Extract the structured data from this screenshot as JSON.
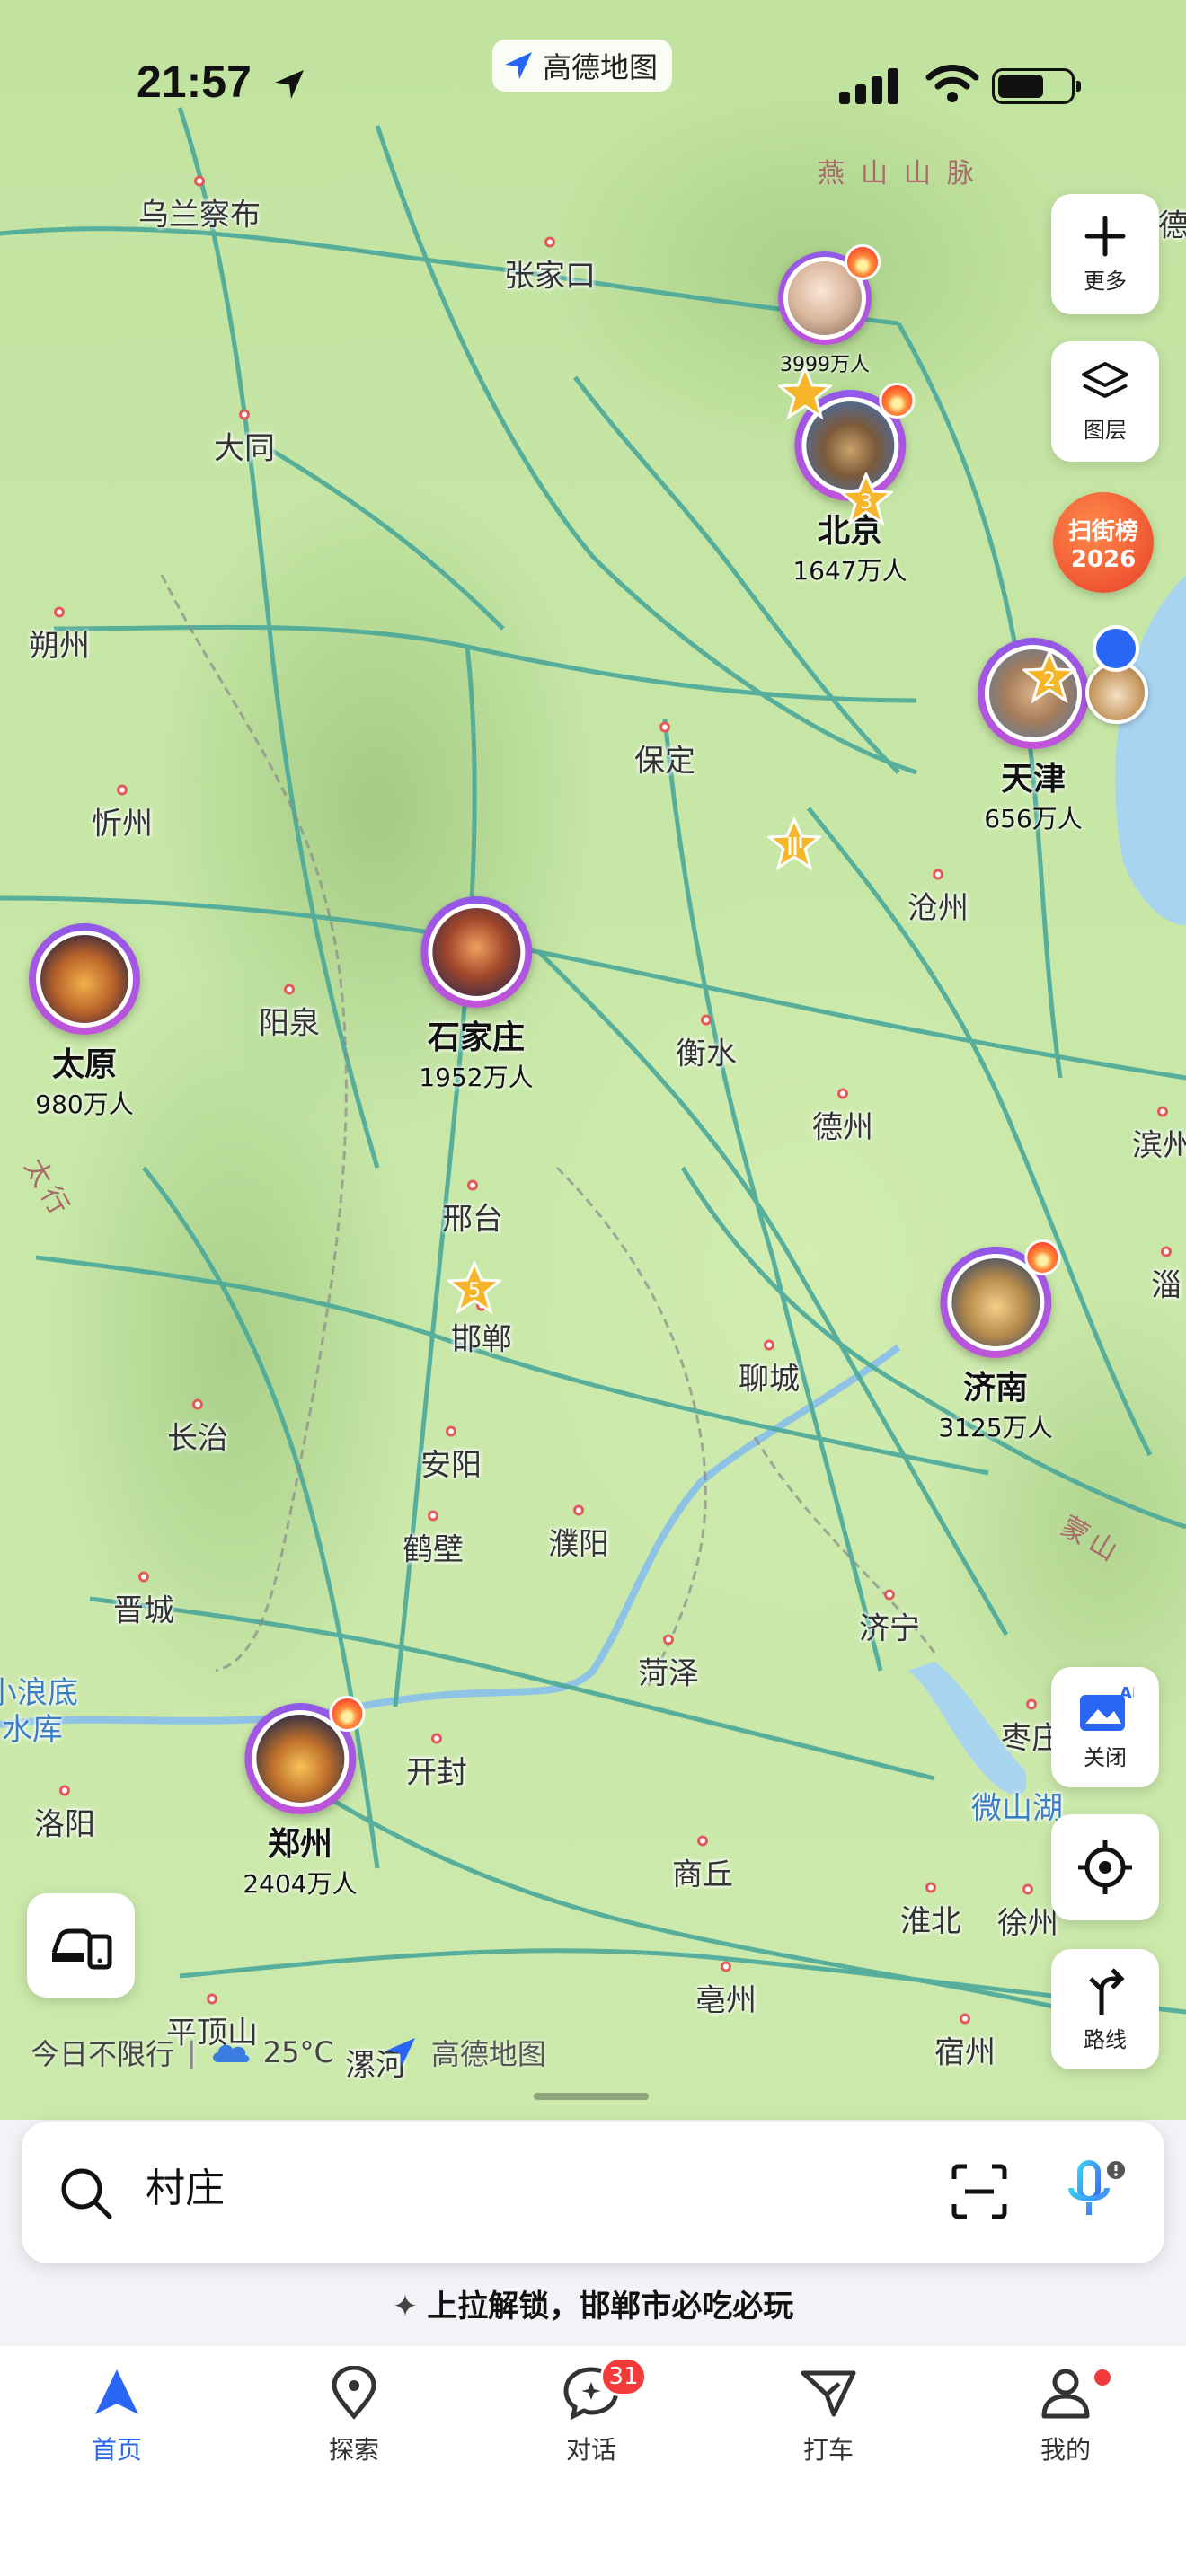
{
  "status": {
    "time": "21:57",
    "app_badge": "高德地图"
  },
  "mountain_labels": {
    "yanshan": "燕山山脉",
    "taihang": "太行",
    "mengshan": "蒙山"
  },
  "cities": {
    "wulanchabu": "乌兰察布",
    "zhangjiakou": "张家口",
    "datong": "大同",
    "shuozhou": "朔州",
    "xinzhou": "忻州",
    "baoding": "保定",
    "cangzhou": "沧州",
    "yangquan": "阳泉",
    "hengshui": "衡水",
    "dezhou": "德州",
    "binzhou": "滨州",
    "xingtai": "邢台",
    "handan": "邯郸",
    "liaocheng": "聊城",
    "zibo": "淄",
    "changzhi": "长治",
    "anyang": "安阳",
    "hebi": "鹤壁",
    "puyang": "濮阳",
    "jincheng": "晋城",
    "jining": "济宁",
    "heze": "菏泽",
    "zaozhuang": "枣庄",
    "xiaolangdi": "小浪底\n水库",
    "weishanhu": "微山湖",
    "luoyang": "洛阳",
    "kaifeng": "开封",
    "shangqiu": "商丘",
    "huaibei": "淮北",
    "xuzhou": "徐州",
    "bozhou": "亳州",
    "suzhou": "宿州",
    "pingdingshan": "平顶山",
    "luohe": "漯河",
    "de": "德"
  },
  "hot_cities": [
    {
      "name": "北京",
      "count": "1647万人",
      "rank": "3"
    },
    {
      "name": "",
      "count": "3999万人"
    },
    {
      "name": "天津",
      "count": "656万人",
      "rank": "2"
    },
    {
      "name": "石家庄",
      "count": "1952万人"
    },
    {
      "name": "太原",
      "count": "980万人"
    },
    {
      "name": "济南",
      "count": "3125万人"
    },
    {
      "name": "郑州",
      "count": "2404万人"
    }
  ],
  "handan_star": "5",
  "controls": {
    "more": "更多",
    "layers": "图层",
    "ar": "关闭",
    "route": "路线",
    "ar_tag": "AR"
  },
  "rank_badge": {
    "line1": "扫街榜",
    "line2": "2026"
  },
  "info_line": {
    "traffic": "今日不限行",
    "weather": "25°C",
    "brand": "高德地图"
  },
  "search": {
    "value": "村庄"
  },
  "promo": {
    "icon": "✦",
    "text": "上拉解锁，邯郸市必吃必玩"
  },
  "tabs": [
    {
      "label": "首页",
      "active": true
    },
    {
      "label": "探索"
    },
    {
      "label": "对话",
      "badge": "31"
    },
    {
      "label": "打车"
    },
    {
      "label": "我的"
    }
  ],
  "colors": {
    "accent": "#2a66f5",
    "badge": "#f23a3a",
    "ring": "#9a5be6"
  }
}
